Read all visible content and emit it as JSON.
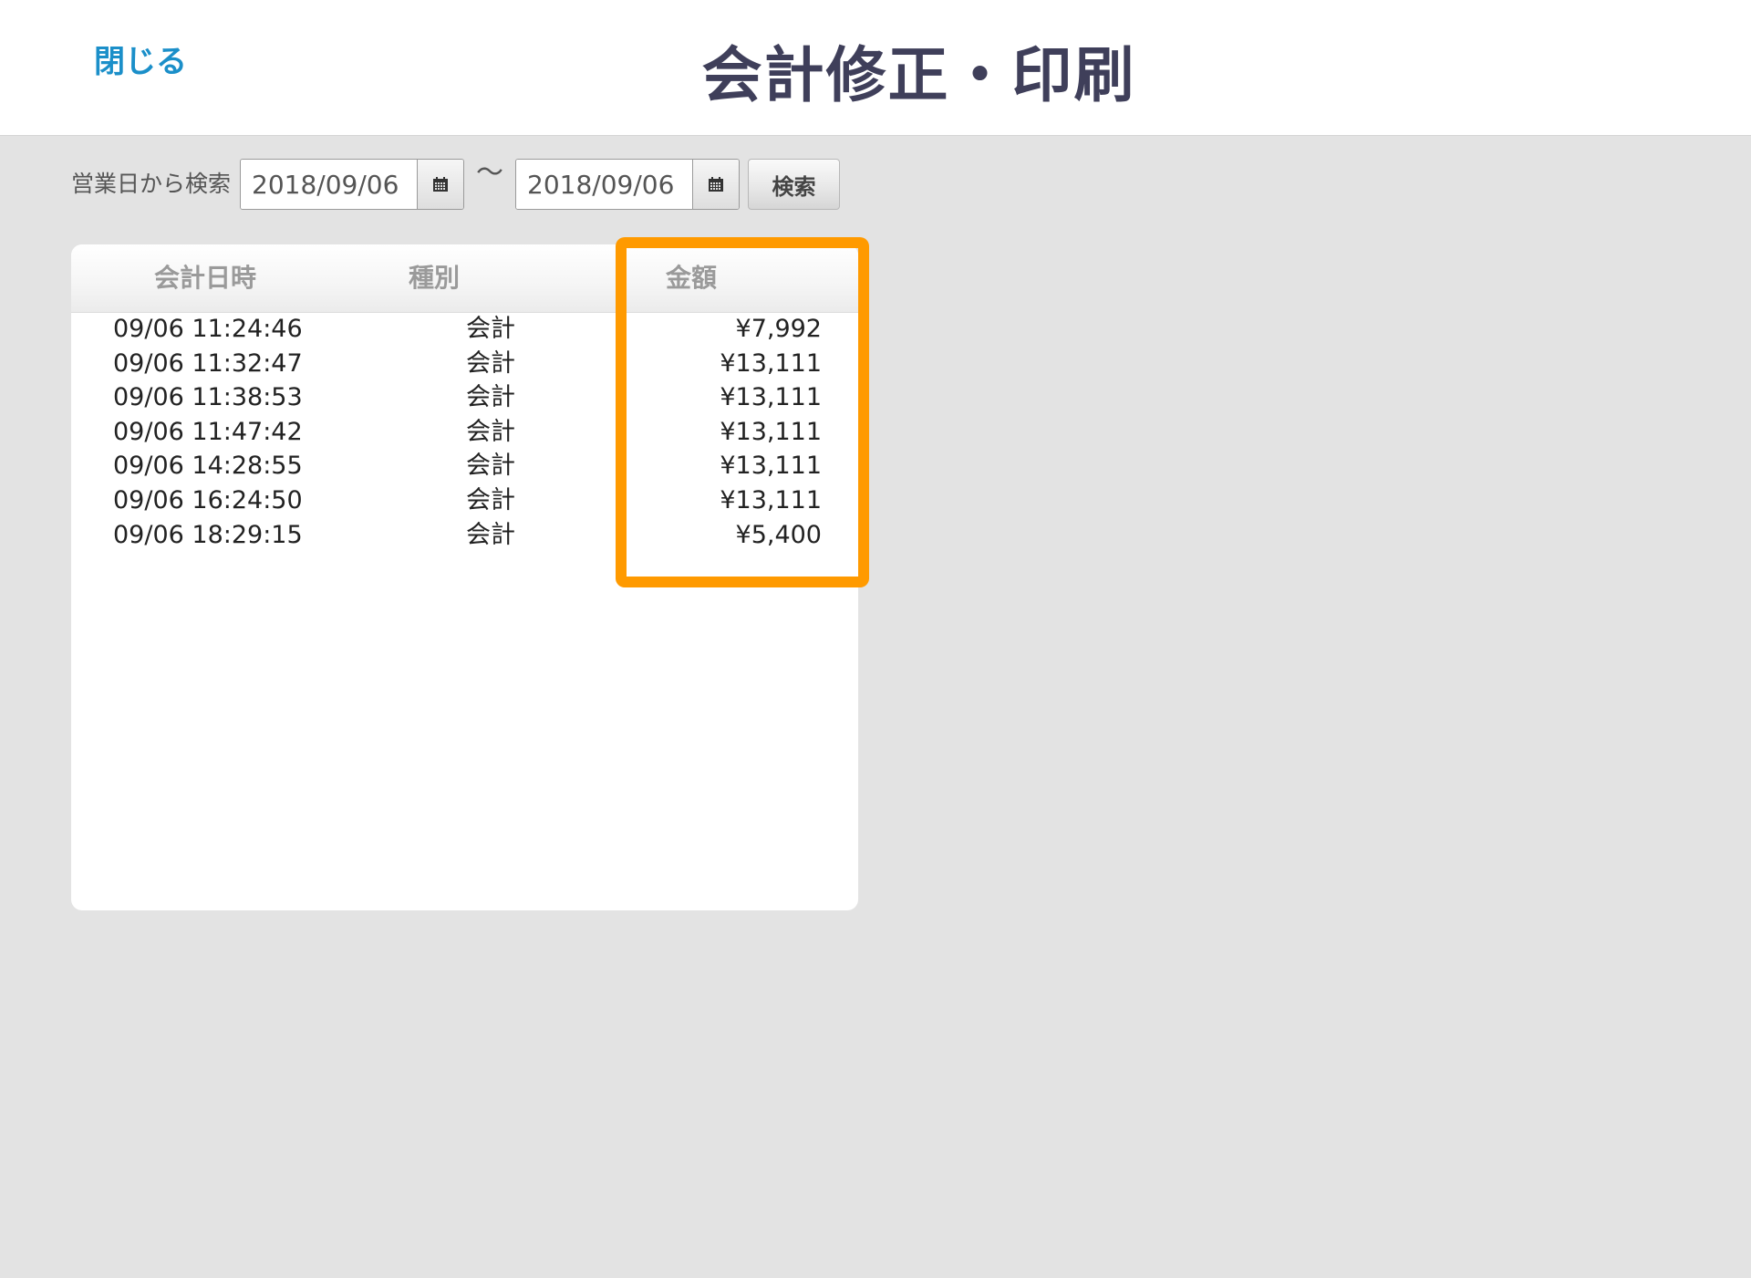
{
  "header": {
    "close_label": "閉じる",
    "title": "会計修正・印刷"
  },
  "search": {
    "label": "営業日から検索",
    "from_date": "2018/09/06",
    "separator": "〜",
    "to_date": "2018/09/06",
    "button_label": "検索",
    "calendar_icon": "calendar-icon"
  },
  "table": {
    "columns": [
      "会計日時",
      "種別",
      "金額"
    ],
    "rows": [
      {
        "datetime": "09/06 11:24:46",
        "type": "会計",
        "amount": "¥7,992"
      },
      {
        "datetime": "09/06 11:32:47",
        "type": "会計",
        "amount": "¥13,111"
      },
      {
        "datetime": "09/06 11:38:53",
        "type": "会計",
        "amount": "¥13,111"
      },
      {
        "datetime": "09/06 11:47:42",
        "type": "会計",
        "amount": "¥13,111"
      },
      {
        "datetime": "09/06 14:28:55",
        "type": "会計",
        "amount": "¥13,111"
      },
      {
        "datetime": "09/06 16:24:50",
        "type": "会計",
        "amount": "¥13,111"
      },
      {
        "datetime": "09/06 18:29:15",
        "type": "会計",
        "amount": "¥5,400"
      }
    ]
  },
  "colors": {
    "accent_link": "#1b8fc9",
    "highlight": "#ff9a00",
    "title": "#3f3f5a",
    "background": "#e3e3e3"
  }
}
